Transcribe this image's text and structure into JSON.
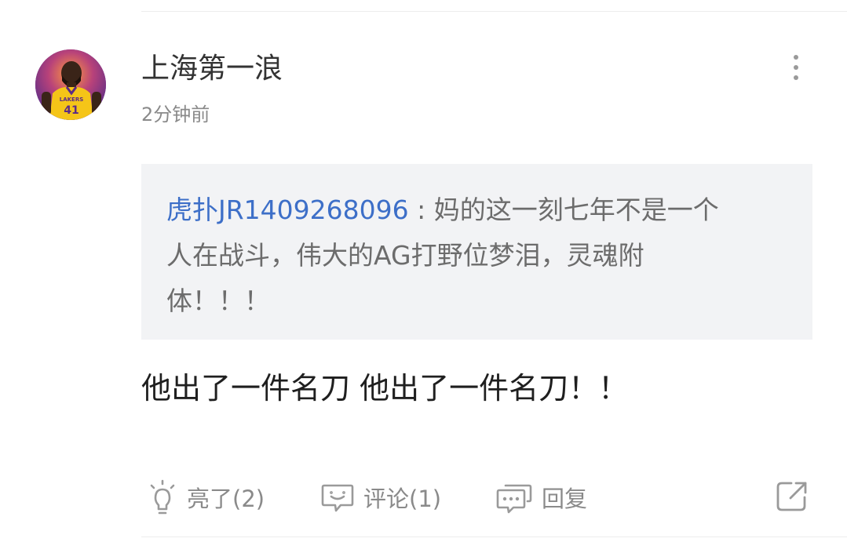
{
  "post": {
    "username": "上海第一浪",
    "timestamp": "2分钟前",
    "avatar_jersey_number": "41",
    "avatar_jersey_text": "LAKERS"
  },
  "quote": {
    "author": "虎扑JR1409268096",
    "separator": " : ",
    "text": "妈的这一刻七年不是一个人在战斗，伟大的AG打野位梦泪，灵魂附体！！！"
  },
  "comment": {
    "text": "他出了一件名刀 他出了一件名刀！！"
  },
  "actions": {
    "like_label": "亮了(2)",
    "comment_label": "评论(1)",
    "reply_label": "回复"
  },
  "icons": {
    "like": "lightbulb-icon",
    "comment": "comment-bubble-icon",
    "reply": "reply-bubble-icon",
    "share": "share-icon",
    "more": "more-vertical-icon"
  },
  "colors": {
    "author_link": "#3d6fc8",
    "quote_background": "#f2f3f5",
    "muted_text": "#8a8a8a"
  }
}
